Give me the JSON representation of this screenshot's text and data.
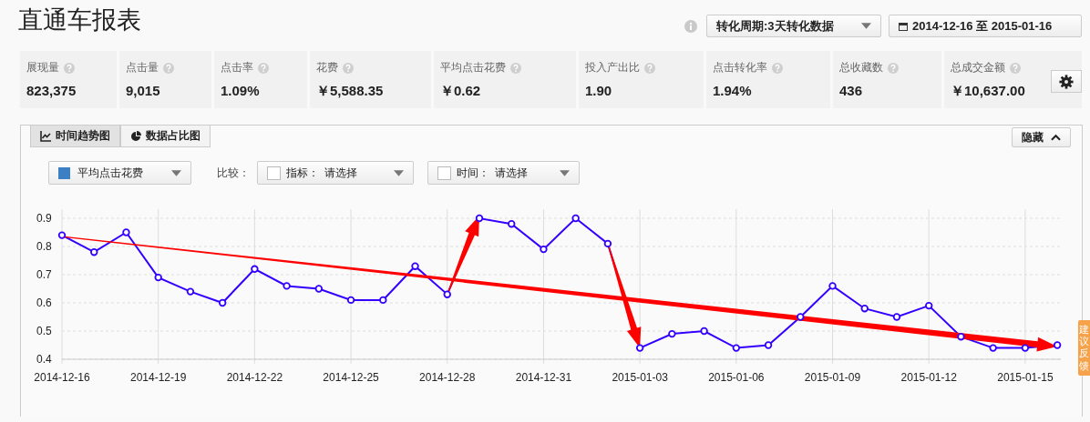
{
  "page": {
    "title": "直通车报表"
  },
  "header": {
    "conversion_select": "转化周期:3天转化数据",
    "date_range": "2014-12-16 至 2015-01-16"
  },
  "metrics": [
    {
      "label": "展现量",
      "value": "823,375"
    },
    {
      "label": "点击量",
      "value": "9,015"
    },
    {
      "label": "点击率",
      "value": "1.09%"
    },
    {
      "label": "花费",
      "value": "￥5,588.35"
    },
    {
      "label": "平均点击花费",
      "value": "￥0.62"
    },
    {
      "label": "投入产出比",
      "value": "1.90"
    },
    {
      "label": "点击转化率",
      "value": "1.94%"
    },
    {
      "label": "总收藏数",
      "value": "436"
    },
    {
      "label": "总成交金额",
      "value": "￥10,637.00"
    }
  ],
  "chart_panel": {
    "tabs": [
      {
        "label": "时间趋势图",
        "kind": "line",
        "selected": true
      },
      {
        "label": "数据占比图",
        "kind": "pie",
        "selected": false
      }
    ],
    "hide_button": "隐藏",
    "metric_select": {
      "label": "平均点击花费",
      "color": "#3b7fc4"
    },
    "compare_label": "比较：",
    "compare_filters": [
      {
        "label": "指标：",
        "placeholder": "请选择",
        "checked": false
      },
      {
        "label": "时间：",
        "placeholder": "请选择",
        "checked": false
      }
    ],
    "chart_data": {
      "type": "line",
      "categories": [
        "2014-12-16",
        null,
        null,
        "2014-12-19",
        null,
        null,
        "2014-12-22",
        null,
        null,
        "2014-12-25",
        null,
        null,
        "2014-12-28",
        null,
        null,
        "2014-12-31",
        null,
        null,
        "2015-01-03",
        null,
        null,
        "2015-01-06",
        null,
        null,
        "2015-01-09",
        null,
        null,
        "2015-01-12",
        null,
        null,
        "2015-01-15",
        null
      ],
      "series": [
        {
          "color": "#3300ff",
          "marker": "circle",
          "values": [
            0.84,
            0.78,
            0.85,
            0.69,
            0.64,
            0.6,
            0.72,
            0.66,
            0.65,
            0.61,
            0.61,
            0.73,
            0.63,
            0.9,
            0.88,
            0.79,
            0.9,
            0.81,
            0.44,
            0.49,
            0.5,
            0.44,
            0.45,
            0.55,
            0.66,
            0.58,
            0.55,
            0.59,
            0.48,
            0.44,
            0.44,
            0.45
          ]
        }
      ],
      "ylim": [
        0.4,
        0.9
      ],
      "yticks": [
        0.4,
        0.5,
        0.6,
        0.7,
        0.8,
        0.9
      ],
      "grid": true
    }
  },
  "feedback_tab": "建议反馈"
}
